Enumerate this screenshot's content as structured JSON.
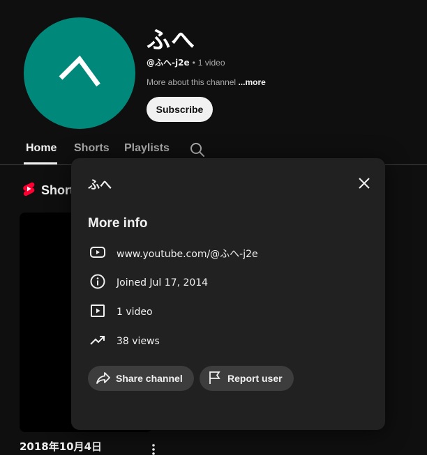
{
  "channel": {
    "name": "ふへ",
    "handle": "@ふへ-j2e",
    "video_count": "1 video",
    "separator": "•",
    "about": "More about this channel",
    "more_label": "...more",
    "subscribe_label": "Subscribe",
    "avatar_color": "#00897b",
    "avatar_icon": "caret-up-glyph"
  },
  "tabs": [
    {
      "label": "Home",
      "active": true
    },
    {
      "label": "Shorts",
      "active": false
    },
    {
      "label": "Playlists",
      "active": false
    }
  ],
  "shorts_section": {
    "heading": "Shorts",
    "item_date": "2018年10月4日"
  },
  "modal": {
    "title": "ふへ",
    "heading": "More info",
    "rows": [
      {
        "icon": "youtube-link-icon",
        "text": "www.youtube.com/@ふへ-j2e"
      },
      {
        "icon": "info-icon",
        "text": "Joined Jul 17, 2014"
      },
      {
        "icon": "video-icon",
        "text": "1 video"
      },
      {
        "icon": "trending-icon",
        "text": "38 views"
      }
    ],
    "share_label": "Share channel",
    "report_label": "Report user"
  },
  "colors": {
    "background": "#0f0f0f",
    "modal_bg": "#212121",
    "pill_bg": "#3d3d3d",
    "shorts_red": "#ff0033"
  }
}
